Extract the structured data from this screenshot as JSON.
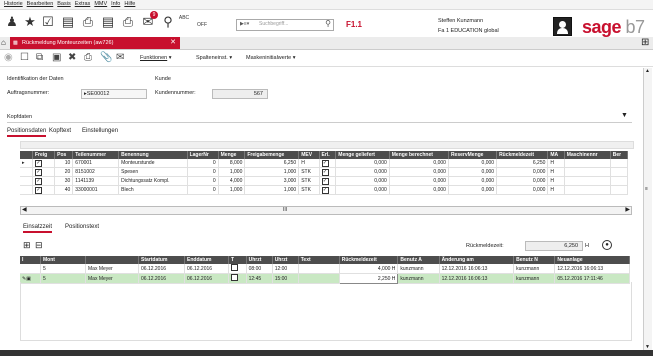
{
  "menu": [
    "Historie",
    "Bearbeiten",
    "Basis",
    "Extras",
    "MMV",
    "Info",
    "Hilfe"
  ],
  "toolbar": {
    "search_placeholder": "Suchbegriff...",
    "fkey": "F1.1",
    "badge": "9",
    "abc": "ABC",
    "off": "OFF"
  },
  "user": {
    "name": "Steffen Kunzmann",
    "company": "Fa 1 EDUCATION global"
  },
  "logo": {
    "brand": "sage",
    "version": "b7"
  },
  "tab": {
    "label": "Rückmeldung Monteurzeiten (aw726)"
  },
  "toolbar2": {
    "funktionen": "Funktionen",
    "spalteneinst": "Spalteneinst.",
    "maskeninitialwerte": "Maskeninitialwerte"
  },
  "ident": {
    "section": "Identifikation der Daten",
    "kunde_section": "Kunde",
    "auftrag_label": "Auftragsnummer:",
    "auftrag_value": "SE00012",
    "kunde_label": "Kundennummer:",
    "kunde_value": "567"
  },
  "kopfdaten": "Kopfdaten",
  "tabs1": [
    "Positionsdaten",
    "Kopftext",
    "Einstellungen"
  ],
  "pos_table": {
    "headers": [
      "Freig",
      "Pos",
      "Teilenummer",
      "Benennung",
      "LagerNr",
      "Menge",
      "Freigabemenge",
      "MEV",
      "Erl.",
      "Menge geliefert",
      "Menge berechnet",
      "ReservMenge",
      "Rückmeldezeit",
      "MA",
      "Maschinennr",
      "Ber"
    ],
    "rows": [
      {
        "pos": "10",
        "teil": "670001",
        "ben": "Monteurstunde",
        "lager": "0",
        "menge": "8,000",
        "freig": "6,250",
        "mev": "H",
        "gel": "0,000",
        "ber": "0,000",
        "res": "0,000",
        "rueck": "6,250",
        "ma": "H"
      },
      {
        "pos": "20",
        "teil": "8151002",
        "ben": "Spesen",
        "lager": "0",
        "menge": "1,000",
        "freig": "1,000",
        "mev": "STK",
        "gel": "0,000",
        "ber": "0,000",
        "res": "0,000",
        "rueck": "0,000",
        "ma": "H"
      },
      {
        "pos": "30",
        "teil": "1141139",
        "ben": "Dichtungssatz Kompl.",
        "lager": "0",
        "menge": "4,000",
        "freig": "3,000",
        "mev": "STK",
        "gel": "0,000",
        "ber": "0,000",
        "res": "0,000",
        "rueck": "0,000",
        "ma": "H"
      },
      {
        "pos": "40",
        "teil": "33000001",
        "ben": "Blech",
        "lager": "0",
        "menge": "1,000",
        "freig": "1,000",
        "mev": "STK",
        "gel": "0,000",
        "ber": "0,000",
        "res": "0,000",
        "rueck": "0,000",
        "ma": "H"
      }
    ]
  },
  "hscroll_glyph": "III",
  "tabs2": [
    "Einsatzzeit",
    "Positionstext"
  ],
  "rueckmeldezeit": {
    "label": "Rückmeldezeit:",
    "value": "6,250",
    "unit": "H"
  },
  "ein_table": {
    "headers": [
      "I",
      "Mont",
      "Startdatum",
      "Enddatum",
      "T",
      "Uhrzt",
      "Uhrzt",
      "Text",
      "Rückmeldezeit",
      "Benutz A",
      "Änderung am",
      "Benutz N",
      "Neuanlage"
    ],
    "rows": [
      {
        "mont": "5",
        "name": "Max Meyer",
        "start": "06.12.2016",
        "end": "06.12.2016",
        "u1": "08:00",
        "u2": "12:00",
        "rueck": "4,000",
        "unit": "H",
        "ba": "kunzmann",
        "aend": "12.12.2016 16:06:13",
        "bn": "kunzmann",
        "neu": "12.12.2016 16:06:13"
      },
      {
        "mont": "5",
        "name": "Max Meyer",
        "start": "06.12.2016",
        "end": "06.12.2016",
        "u1": "12:45",
        "u2": "15:00",
        "rueck": "2,250",
        "unit": "H",
        "ba": "kunzmann",
        "aend": "12.12.2016 16:06:13",
        "bn": "kunzmann",
        "neu": "05.12.2016 17:11:46"
      }
    ]
  },
  "colors": {
    "brand_red": "#c8102e",
    "selected_row": "#c9e8c3",
    "header_dark": "#4d4d4d"
  }
}
